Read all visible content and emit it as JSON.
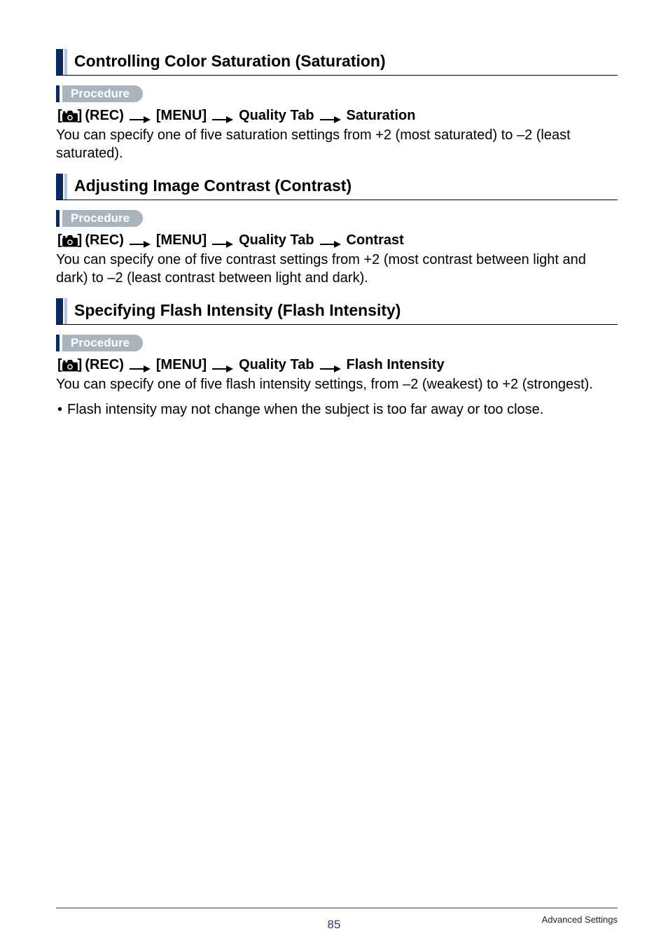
{
  "sections": [
    {
      "title": "Controlling Color Saturation (Saturation)",
      "procedureLabel": "Procedure",
      "crumb": {
        "preBracket": "[",
        "postBracket": "]",
        "rec": "(REC)",
        "menu": "[MENU]",
        "tab": "Quality Tab",
        "last": "Saturation"
      },
      "para": "You can specify one of five saturation settings from +2 (most saturated) to –2 (least saturated)."
    },
    {
      "title": "Adjusting Image Contrast (Contrast)",
      "procedureLabel": "Procedure",
      "crumb": {
        "preBracket": "[",
        "postBracket": "]",
        "rec": "(REC)",
        "menu": "[MENU]",
        "tab": "Quality Tab",
        "last": "Contrast"
      },
      "para": "You can specify one of five contrast settings from +2 (most contrast between light and dark) to –2 (least contrast between light and dark)."
    },
    {
      "title": "Specifying Flash Intensity (Flash Intensity)",
      "procedureLabel": "Procedure",
      "crumb": {
        "preBracket": "[",
        "postBracket": "]",
        "rec": "(REC)",
        "menu": "[MENU]",
        "tab": "Quality Tab",
        "last": "Flash Intensity"
      },
      "para": "You can specify one of five flash intensity settings, from –2 (weakest) to +2 (strongest).",
      "bullet": "Flash intensity may not change when the subject is too far away or too close."
    }
  ],
  "footer": {
    "pageNumber": "85",
    "sectionLabel": "Advanced Settings"
  }
}
